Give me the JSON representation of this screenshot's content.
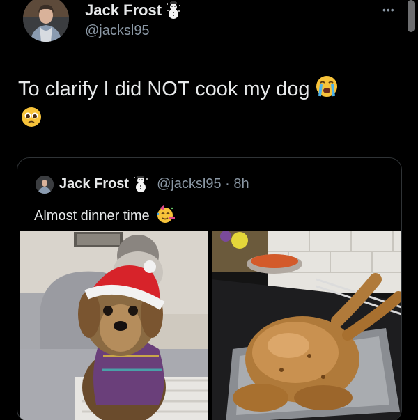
{
  "author": {
    "name": "Jack Frost",
    "handle": "@jacksl95"
  },
  "tweet": {
    "text": "To clarify I did NOT cook my dog"
  },
  "more_label": "•••",
  "quoted": {
    "name": "Jack Frost",
    "handle_time": "@jacksl95 · 8h",
    "text": "Almost dinner time"
  },
  "icons": {
    "badge": "snowman-icon",
    "crying": "loudly-crying-face-icon",
    "pleading": "pleading-face-icon",
    "party": "partying-face-icon"
  },
  "colors": {
    "background": "#000000",
    "text": "#e7e9ea",
    "secondary": "#8b98a5",
    "border": "#2f3336"
  }
}
